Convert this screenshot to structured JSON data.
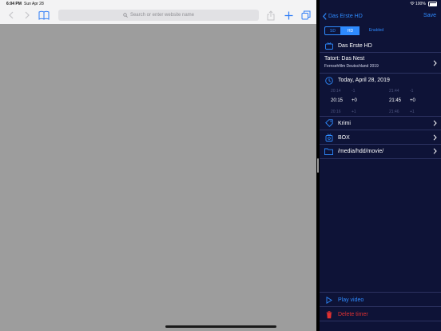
{
  "status_bar": {
    "time": "6:04 PM",
    "date": "Sun Apr 28",
    "battery": "100%"
  },
  "safari": {
    "address_placeholder": "Search or enter website name",
    "icons": {
      "back": "chevron-left-icon",
      "forward": "chevron-right-icon",
      "bookmarks": "book-icon",
      "search": "magnifier-icon",
      "share": "share-icon",
      "new_tab": "plus-icon",
      "tabs": "tabs-icon"
    }
  },
  "app": {
    "nav": {
      "back_label": "Das Erste HD",
      "save_label": "Save"
    },
    "segment": {
      "sd": "SD",
      "hd": "HD",
      "enabled": "Enabled"
    },
    "channel": "Das Erste HD",
    "event": {
      "title": "Tatort: Das Nest",
      "subtitle": "Fernsehfilm Deutschland 2019"
    },
    "date": "Today, April 28, 2019",
    "start_picker": {
      "above": {
        "time": "20:14",
        "offset": "-1"
      },
      "selected": {
        "time": "20:15",
        "offset": "+0"
      },
      "below": {
        "time": "20:16",
        "offset": "+1"
      }
    },
    "end_picker": {
      "above": {
        "time": "21:44",
        "offset": "-1"
      },
      "selected": {
        "time": "21:45",
        "offset": "+0"
      },
      "below": {
        "time": "21:46",
        "offset": "+1"
      }
    },
    "tags": "Krimi",
    "folder": "BOX",
    "location": "/media/hdd/movie/",
    "play_label": "Play video",
    "delete_label": "Delete timer",
    "colors": {
      "background": "#0e1337",
      "accent": "#2e8bff",
      "danger": "#e03131"
    }
  }
}
